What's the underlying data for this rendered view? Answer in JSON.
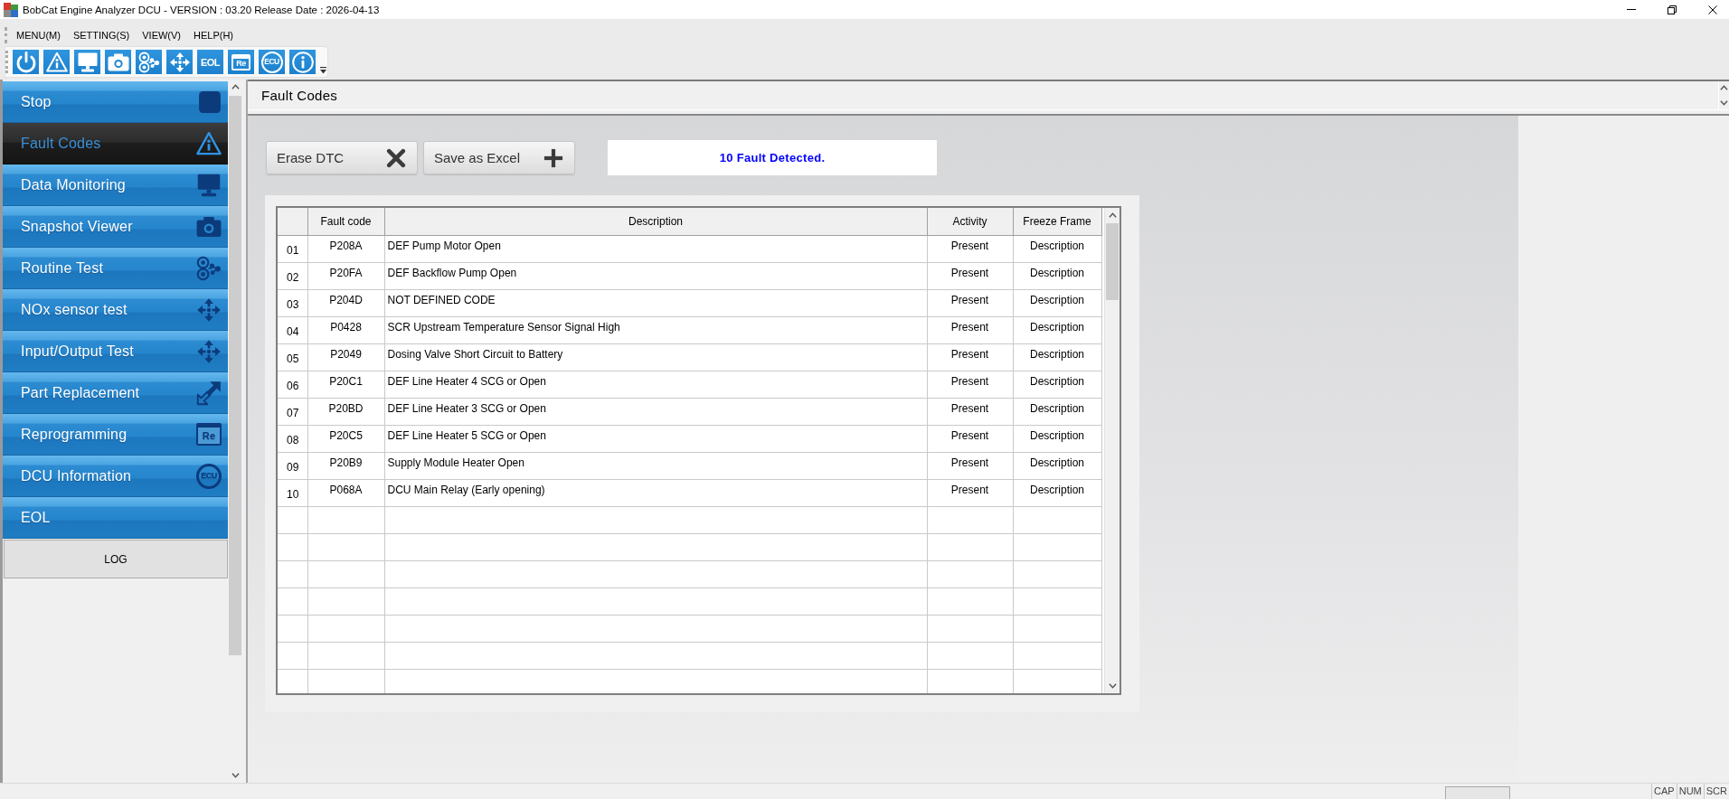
{
  "window": {
    "title": "BobCat Engine Analyzer DCU - VERSION : 03.20 Release Date : 2026-04-13"
  },
  "menu": [
    "MENU(M)",
    "SETTING(S)",
    "VIEW(V)",
    "HELP(H)"
  ],
  "toolbar": [
    {
      "kind": "power"
    },
    {
      "kind": "warning"
    },
    {
      "kind": "monitor"
    },
    {
      "kind": "camera"
    },
    {
      "kind": "routine"
    },
    {
      "kind": "arrows"
    },
    {
      "kind": "label",
      "text": "EOL"
    },
    {
      "kind": "document",
      "text": "Re"
    },
    {
      "kind": "badge",
      "text": "ECU"
    },
    {
      "kind": "info"
    }
  ],
  "sidebar": {
    "items": [
      {
        "label": "Stop",
        "kind": "square",
        "selected": false
      },
      {
        "label": "Fault Codes",
        "kind": "warning",
        "selected": true
      },
      {
        "label": "Data Monitoring",
        "kind": "monitor",
        "selected": false
      },
      {
        "label": "Snapshot Viewer",
        "kind": "camera",
        "selected": false
      },
      {
        "label": "Routine Test",
        "kind": "routine",
        "selected": false
      },
      {
        "label": "NOx sensor test",
        "kind": "arrows",
        "selected": false
      },
      {
        "label": "Input/Output Test",
        "kind": "arrows",
        "selected": false
      },
      {
        "label": "Part Replacement",
        "kind": "swap",
        "selected": false
      },
      {
        "label": "Reprogramming",
        "kind": "document",
        "text": "Re",
        "selected": false
      },
      {
        "label": "DCU Information",
        "kind": "badge",
        "text": "ECU",
        "selected": false
      },
      {
        "label": "EOL",
        "kind": "plain",
        "selected": false
      }
    ],
    "log_button": "LOG"
  },
  "panel": {
    "title": "Fault Codes"
  },
  "actions": [
    {
      "label": "Erase DTC",
      "kind": "erase"
    },
    {
      "label": "Save as Excel",
      "kind": "add"
    }
  ],
  "message": "10 Fault Detected.",
  "table": {
    "columns": [
      "Fault code",
      "Description",
      "Activity",
      "Freeze Frame"
    ],
    "rows": [
      {
        "number": "01",
        "fault_code": "P208A",
        "description": "DEF Pump Motor Open",
        "activity": "Present",
        "freeze_frame": "Description"
      },
      {
        "number": "02",
        "fault_code": "P20FA",
        "description": "DEF Backflow Pump Open",
        "activity": "Present",
        "freeze_frame": "Description"
      },
      {
        "number": "03",
        "fault_code": "P204D",
        "description": "NOT DEFINED CODE",
        "activity": "Present",
        "freeze_frame": "Description"
      },
      {
        "number": "04",
        "fault_code": "P0428",
        "description": "SCR Upstream Temperature Sensor Signal High",
        "activity": "Present",
        "freeze_frame": "Description"
      },
      {
        "number": "05",
        "fault_code": "P2049",
        "description": "Dosing Valve Short Circuit to Battery",
        "activity": "Present",
        "freeze_frame": "Description"
      },
      {
        "number": "06",
        "fault_code": "P20C1",
        "description": "DEF Line Heater 4 SCG or Open",
        "activity": "Present",
        "freeze_frame": "Description"
      },
      {
        "number": "07",
        "fault_code": "P20BD",
        "description": "DEF Line Heater 3 SCG or Open",
        "activity": "Present",
        "freeze_frame": "Description"
      },
      {
        "number": "08",
        "fault_code": "P20C5",
        "description": "DEF Line Heater 5 SCG or Open",
        "activity": "Present",
        "freeze_frame": "Description"
      },
      {
        "number": "09",
        "fault_code": "P20B9",
        "description": "Supply Module Heater Open",
        "activity": "Present",
        "freeze_frame": "Description"
      },
      {
        "number": "10",
        "fault_code": "P068A",
        "description": "DCU Main Relay (Early opening)",
        "activity": "Present",
        "freeze_frame": "Description"
      }
    ]
  },
  "status_bar": {
    "indicators": [
      "CAP",
      "NUM",
      "SCR"
    ]
  }
}
